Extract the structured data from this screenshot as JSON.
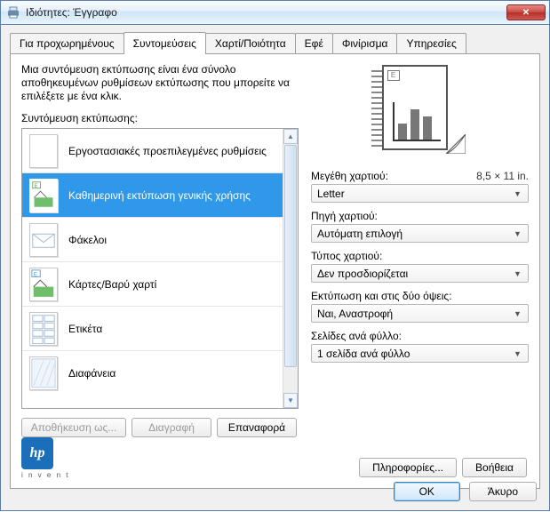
{
  "window": {
    "title_prefix": "Ιδιότητες:",
    "title_muted": "",
    "title_suffix": "Έγγραφο",
    "close": "✕"
  },
  "tabs": [
    {
      "label": "Για προχωρημένους"
    },
    {
      "label": "Συντομεύσεις"
    },
    {
      "label": "Χαρτί/Ποιότητα"
    },
    {
      "label": "Εφέ"
    },
    {
      "label": "Φινίρισμα"
    },
    {
      "label": "Υπηρεσίες"
    }
  ],
  "active_tab_index": 1,
  "panel": {
    "description": "Μια συντόμευση εκτύπωσης είναι ένα σύνολο αποθηκευμένων ρυθμίσεων εκτύπωσης που μπορείτε να επιλέξετε με ένα κλικ.",
    "list_label": "Συντόμευση εκτύπωσης:",
    "items": [
      {
        "label": "Εργοστασιακές προεπιλεγμένες ρυθμίσεις",
        "icon": "blank"
      },
      {
        "label": "Καθημερινή εκτύπωση γενικής χρήσης",
        "icon": "general",
        "selected": true
      },
      {
        "label": "Φάκελοι",
        "icon": "envelope"
      },
      {
        "label": "Κάρτες/Βαρύ χαρτί",
        "icon": "card"
      },
      {
        "label": "Ετικέτα",
        "icon": "labels"
      },
      {
        "label": "Διαφάνεια",
        "icon": "transparency"
      }
    ],
    "buttons": {
      "save_as": "Αποθήκευση ως...",
      "delete": "Διαγραφή",
      "reset": "Επαναφορά"
    }
  },
  "form": {
    "paper_size": {
      "label": "Μεγέθη χαρτιού:",
      "hint": "8,5 × 11 in.",
      "value": "Letter"
    },
    "paper_source": {
      "label": "Πηγή χαρτιού:",
      "value": "Αυτόματη επιλογή"
    },
    "paper_type": {
      "label": "Τύπος χαρτιού:",
      "value": "Δεν προσδιορίζεται"
    },
    "duplex": {
      "label": "Εκτύπωση και στις δύο όψεις:",
      "value": "Ναι, Αναστροφή"
    },
    "pages_per_sheet": {
      "label": "Σελίδες ανά φύλλο:",
      "value": "1 σελίδα ανά φύλλο"
    }
  },
  "right_buttons": {
    "about": "Πληροφορίες...",
    "help": "Βοήθεια"
  },
  "footer": {
    "ok": "OK",
    "cancel": "Άκυρο"
  },
  "logo": {
    "text": "hp",
    "sub": "i n v e n t"
  }
}
